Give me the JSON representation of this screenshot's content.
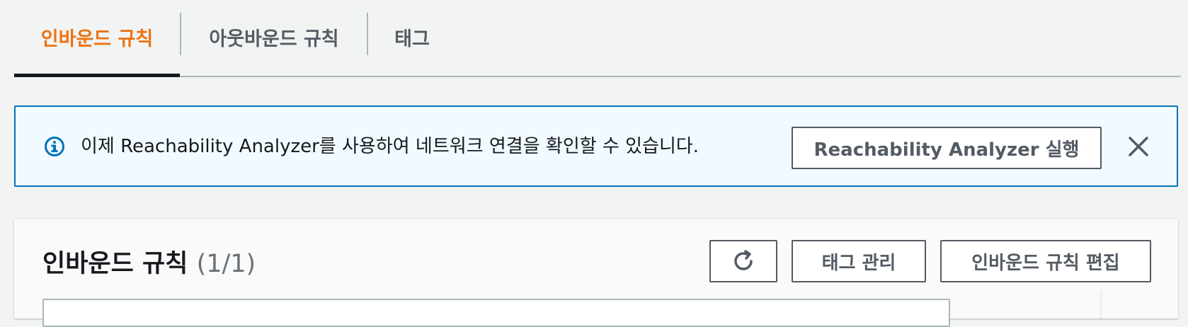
{
  "tabs": [
    {
      "label": "인바운드 규칙",
      "active": true
    },
    {
      "label": "아웃바운드 규칙",
      "active": false
    },
    {
      "label": "태그",
      "active": false
    }
  ],
  "flash": {
    "type": "info",
    "icon": "info-circle-icon",
    "message": "이제 Reachability Analyzer를 사용하여 네트워크 연결을 확인할 수 있습니다.",
    "action_label": "Reachability Analyzer 실행",
    "dismiss_icon": "close-icon"
  },
  "panel": {
    "title": "인바운드 규칙",
    "count": "(1/1)",
    "refresh_icon": "refresh-icon",
    "manage_tags_label": "태그 관리",
    "edit_rules_label": "인바운드 규칙 편집"
  },
  "colors": {
    "accent": "#ec7211",
    "info_border": "#0073bb",
    "info_bg": "#f1faff",
    "info_icon": "#0073bb",
    "text": "#16191f",
    "secondary_text": "#545b64"
  }
}
